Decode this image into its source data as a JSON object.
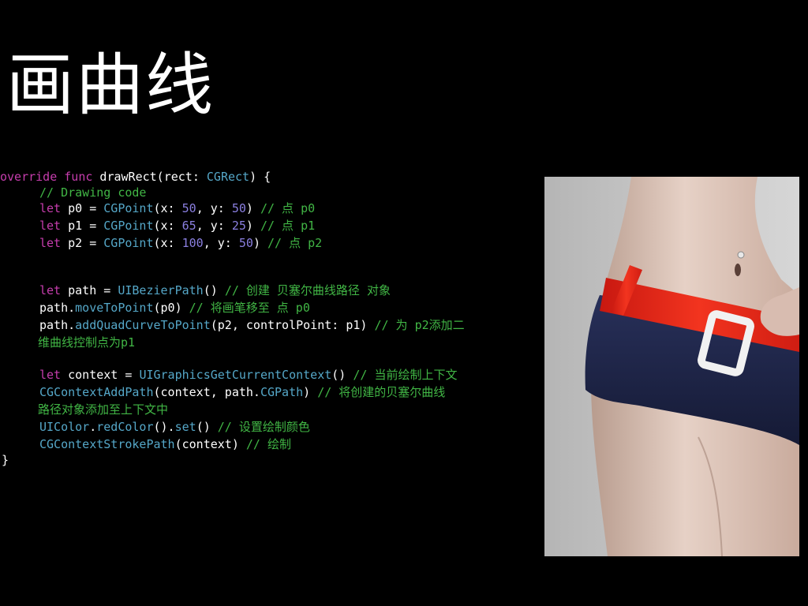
{
  "slide": {
    "title": "画曲线"
  },
  "code": {
    "l1": [
      "override",
      " ",
      "func",
      " drawRect(rect: ",
      "CGRect",
      ") {"
    ],
    "l2": [
      "// Drawing code"
    ],
    "l3": [
      "let",
      " p0 = ",
      "CGPoint",
      "(x: ",
      "50",
      ", y: ",
      "50",
      ") ",
      "// 点 p0"
    ],
    "l4": [
      "let",
      " p1 = ",
      "CGPoint",
      "(x: ",
      "65",
      ", y: ",
      "25",
      ") ",
      "// 点 p1"
    ],
    "l5": [
      "let",
      " p2 = ",
      "CGPoint",
      "(x: ",
      "100",
      ", y: ",
      "50",
      ") ",
      "// 点 p2"
    ],
    "l6": [
      "let",
      " path = ",
      "UIBezierPath",
      "() ",
      "// 创建 贝塞尔曲线路径 对象"
    ],
    "l7": [
      "path.",
      "moveToPoint",
      "(p0) ",
      "// 将画笔移至 点 p0"
    ],
    "l8": [
      "path.",
      "addQuadCurveToPoint",
      "(p2, controlPoint: p1) ",
      "// 为 p2添加二"
    ],
    "l9": [
      "维曲线控制点为p1"
    ],
    "l10": [
      "let",
      " context = ",
      "UIGraphicsGetCurrentContext",
      "() ",
      "// 当前绘制上下文"
    ],
    "l11": [
      "CGContextAddPath",
      "(context, path.",
      "CGPath",
      ") ",
      "// 将创建的贝塞尔曲线"
    ],
    "l12": [
      "路径对象添加至上下文中"
    ],
    "l13": [
      "UIColor",
      ".",
      "redColor",
      "().",
      "set",
      "() ",
      "// 设置绘制颜色"
    ],
    "l14": [
      "CGContextStrokePath",
      "(context) ",
      "// 绘制"
    ],
    "l15": [
      "}"
    ]
  },
  "colors": {
    "background": "#000000",
    "keyword": "#c63dad",
    "type": "#55a7c8",
    "number": "#8a7fe0",
    "comment": "#41b645",
    "belt": "#e8281e",
    "shorts": "#1e2547"
  },
  "image": {
    "subject": "photo-model-red-belt"
  }
}
